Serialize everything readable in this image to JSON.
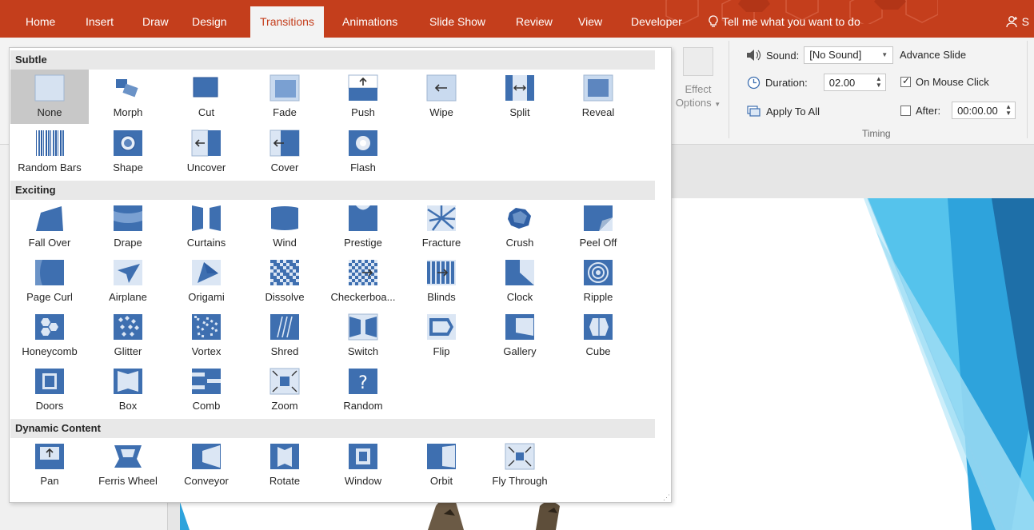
{
  "tabs": [
    "Home",
    "Insert",
    "Draw",
    "Design",
    "Transitions",
    "Animations",
    "Slide Show",
    "Review",
    "View",
    "Developer"
  ],
  "active_tab": "Transitions",
  "tell_me": "Tell me what you want to do",
  "share_label": "S",
  "ribbon": {
    "effect_label_1": "Effect",
    "effect_label_2": "Options",
    "sound_label": "Sound:",
    "sound_value": "[No Sound]",
    "duration_label": "Duration:",
    "duration_value": "02.00",
    "apply_all": "Apply To All",
    "advance_title": "Advance Slide",
    "on_mouse_click": "On Mouse Click",
    "on_mouse_click_checked": true,
    "after_label": "After:",
    "after_value": "00:00.00",
    "after_checked": false,
    "group_timing": "Timing"
  },
  "gallery": {
    "sections": [
      {
        "title": "Subtle",
        "items": [
          {
            "label": "None",
            "selected": true
          },
          {
            "label": "Morph"
          },
          {
            "label": "Cut"
          },
          {
            "label": "Fade"
          },
          {
            "label": "Push"
          },
          {
            "label": "Wipe"
          },
          {
            "label": "Split"
          },
          {
            "label": "Reveal"
          },
          {
            "label": "Random Bars"
          },
          {
            "label": "Shape"
          },
          {
            "label": "Uncover"
          },
          {
            "label": "Cover"
          },
          {
            "label": "Flash"
          }
        ]
      },
      {
        "title": "Exciting",
        "items": [
          {
            "label": "Fall Over"
          },
          {
            "label": "Drape"
          },
          {
            "label": "Curtains"
          },
          {
            "label": "Wind"
          },
          {
            "label": "Prestige"
          },
          {
            "label": "Fracture"
          },
          {
            "label": "Crush"
          },
          {
            "label": "Peel Off"
          },
          {
            "label": "Page Curl"
          },
          {
            "label": "Airplane"
          },
          {
            "label": "Origami"
          },
          {
            "label": "Dissolve"
          },
          {
            "label": "Checkerboa..."
          },
          {
            "label": "Blinds"
          },
          {
            "label": "Clock"
          },
          {
            "label": "Ripple"
          },
          {
            "label": "Honeycomb"
          },
          {
            "label": "Glitter"
          },
          {
            "label": "Vortex"
          },
          {
            "label": "Shred"
          },
          {
            "label": "Switch"
          },
          {
            "label": "Flip"
          },
          {
            "label": "Gallery"
          },
          {
            "label": "Cube"
          },
          {
            "label": "Doors"
          },
          {
            "label": "Box"
          },
          {
            "label": "Comb"
          },
          {
            "label": "Zoom"
          },
          {
            "label": "Random"
          }
        ]
      },
      {
        "title": "Dynamic Content",
        "items": [
          {
            "label": "Pan"
          },
          {
            "label": "Ferris Wheel"
          },
          {
            "label": "Conveyor"
          },
          {
            "label": "Rotate"
          },
          {
            "label": "Window"
          },
          {
            "label": "Orbit"
          },
          {
            "label": "Fly Through"
          }
        ]
      }
    ]
  },
  "colors": {
    "tab_bar": "#c43e1c",
    "icon_blue": "#3e6fb0",
    "icon_light": "#c9daef",
    "slide_accent": "#2ea3dc"
  }
}
